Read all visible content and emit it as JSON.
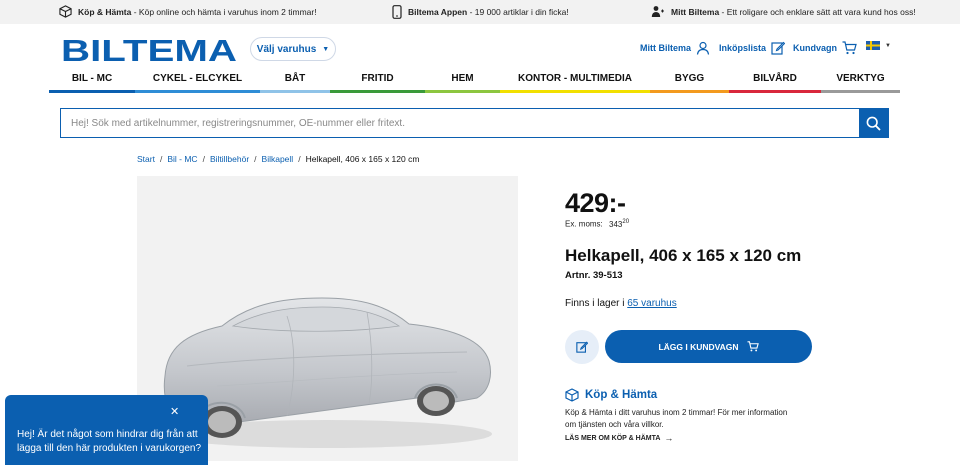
{
  "usp_bar": {
    "items": [
      {
        "title": "Köp & Hämta",
        "text": " - Köp online och hämta i varuhus inom 2 timmar!",
        "icon": "box-icon"
      },
      {
        "title": "Biltema Appen",
        "text": " - 19 000 artiklar i din ficka!",
        "icon": "phone-icon"
      },
      {
        "title": "Mitt Biltema",
        "text": " - Ett roligare och enklare sätt att vara kund hos oss!",
        "icon": "person-icon"
      }
    ]
  },
  "header": {
    "logo_text": "BILTEMA",
    "brand_color": "#0b5fb0",
    "store_select": "Välj varuhus",
    "links": {
      "account": "Mitt Biltema",
      "shopping_list": "Inköpslista",
      "cart": "Kundvagn"
    },
    "language": "Svenska"
  },
  "nav": {
    "items": [
      {
        "label": "BIL - MC",
        "color": "#0b5fb0"
      },
      {
        "label": "CYKEL - ELCYKEL",
        "color": "#2f8dd6"
      },
      {
        "label": "BÅT",
        "color": "#8fc3e8"
      },
      {
        "label": "FRITID",
        "color": "#3a9a3a"
      },
      {
        "label": "HEM",
        "color": "#8cc63f"
      },
      {
        "label": "KONTOR - MULTIMEDIA",
        "color": "#f2e000"
      },
      {
        "label": "BYGG",
        "color": "#f39a1e"
      },
      {
        "label": "BILVÅRD",
        "color": "#d9283c"
      },
      {
        "label": "VERKTYG",
        "color": "#9a9a9a"
      }
    ]
  },
  "search": {
    "placeholder": "Hej! Sök med artikelnummer, registreringsnummer, OE-nummer eller fritext."
  },
  "breadcrumb": {
    "items": [
      "Start",
      "Bil - MC",
      "Biltillbehör",
      "Bilkapell"
    ],
    "current": "Helkapell, 406 x 165 x 120 cm"
  },
  "product": {
    "price": "429:-",
    "ex_vat_label": "Ex. moms:",
    "ex_vat_value": "343",
    "ex_vat_decimals": "20",
    "title": "Helkapell, 406 x 165 x 120 cm",
    "artnr": "Artnr. 39-513",
    "stock_prefix": "Finns i lager i ",
    "stock_link": "65 varuhus",
    "add_to_cart": "LÄGG I KUNDVAGN"
  },
  "click_collect": {
    "title": "Köp & Hämta",
    "text": "Köp & Hämta i ditt varuhus inom 2 timmar! För mer information om tjänsten och våra villkor.",
    "more": "LÄS MER OM KÖP & HÄMTA"
  },
  "chat": {
    "message": "Hej! Är det något som hindrar dig från att lägga till den här produkten i varukorgen?"
  }
}
